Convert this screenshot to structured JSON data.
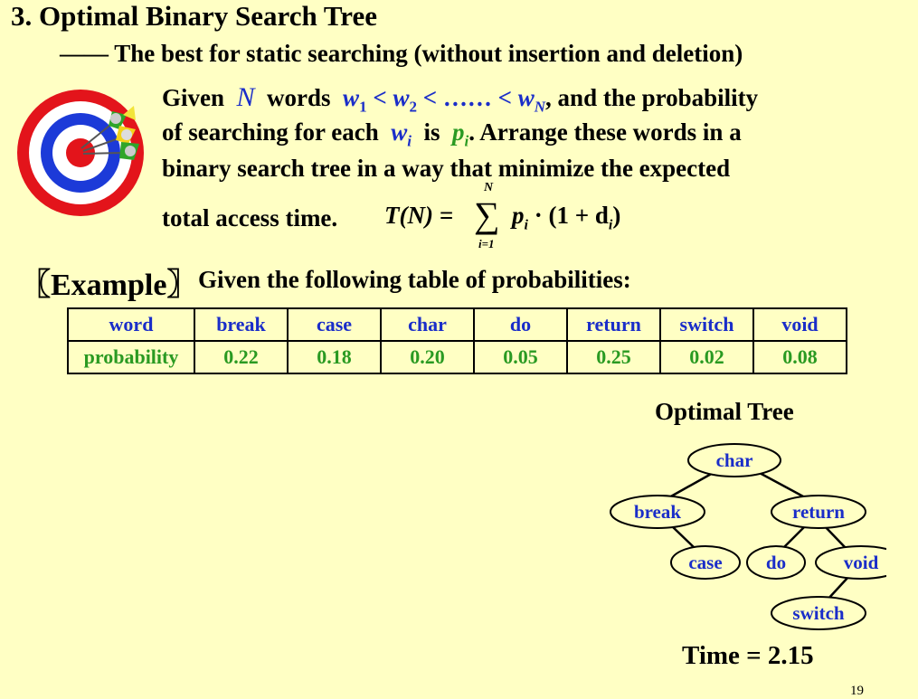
{
  "slide": {
    "title": "3.  Optimal Binary Search Tree",
    "subtitle": "—— The best for static searching (without insertion and deletion)",
    "page_number": "19"
  },
  "intro": {
    "line1": {
      "given": "Given",
      "N": "N",
      "words": "words",
      "w1": "w",
      "sub1": "1",
      "lt1": "<",
      "w2": "w",
      "sub2": "2",
      "lt2": "< …… <",
      "wN": "w",
      "subN": "N",
      "rest": ", and the probability"
    },
    "line2": {
      "pre": "of searching for each",
      "wi": "w",
      "subi": "i",
      "is": "is",
      "pi": "p",
      "subpi": "i",
      "post": ".  Arrange these words in a"
    },
    "line3": "binary search tree in a way that minimize the expected",
    "line4": {
      "text": "total access time.",
      "formula_lhs": "T(N) =",
      "sum_top": "N",
      "sum_bottom": "i=1",
      "sum_symbol": "∑",
      "formula_rhs_p": "p",
      "formula_rhs_sub": "i",
      "formula_rhs_rest": "· (1 + d",
      "formula_rhs_sub2": "i",
      "formula_close": ")"
    }
  },
  "example": {
    "label": "〖Example〗",
    "description": "Given the following table of probabilities:"
  },
  "table": {
    "header_label": "word",
    "row_label": "probability",
    "words": [
      "break",
      "case",
      "char",
      "do",
      "return",
      "switch",
      "void"
    ],
    "probabilities": [
      "0.22",
      "0.18",
      "0.20",
      "0.05",
      "0.25",
      "0.02",
      "0.08"
    ]
  },
  "tree": {
    "title": "Optimal Tree",
    "time": "Time = 2.15",
    "nodes": {
      "root": "char",
      "left": "break",
      "right": "return",
      "left_right": "case",
      "right_left": "do",
      "right_right": "void",
      "right_right_left": "switch"
    }
  },
  "colors": {
    "background": "#ffffc4",
    "blue_text": "#1a2dc9",
    "green_text": "#2a9a22"
  }
}
